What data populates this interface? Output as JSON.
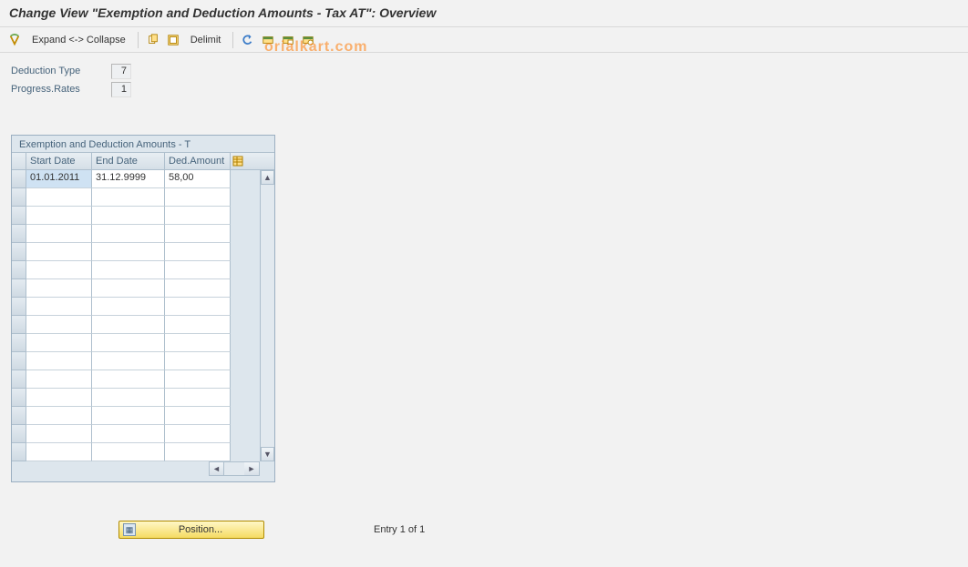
{
  "title": "Change View \"Exemption and Deduction Amounts - Tax AT\": Overview",
  "watermark": "orialkart.com",
  "toolbar": {
    "expand_collapse": "Expand <-> Collapse",
    "delimit": "Delimit"
  },
  "header": {
    "deduction_type_label": "Deduction Type",
    "deduction_type_value": "7",
    "progress_rates_label": "Progress.Rates",
    "progress_rates_value": "1"
  },
  "table": {
    "title": "Exemption and Deduction Amounts - T",
    "columns": {
      "start": "Start Date",
      "end": "End Date",
      "amount": "Ded.Amount"
    },
    "rows": [
      {
        "start": "01.01.2011",
        "end": "31.12.9999",
        "amount": "58,00"
      }
    ],
    "empty_row_count": 15
  },
  "footer": {
    "position_label": "Position...",
    "entry_text": "Entry 1 of 1"
  }
}
